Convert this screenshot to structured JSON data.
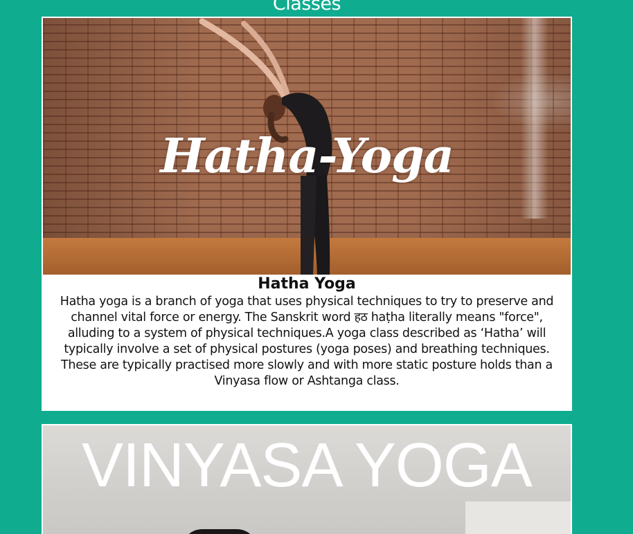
{
  "page": {
    "section_heading": "Classes"
  },
  "classes": [
    {
      "image_caption": "Hatha-Yoga",
      "title": "Hatha Yoga",
      "description": "Hatha yoga is a branch of yoga that uses physical techniques to try to preserve and channel vital force or energy. The Sanskrit word हठ haṭha literally means \"force\", alluding to a system of physical techniques.A yoga class described as ‘Hatha’ will typically involve a set of physical postures (yoga poses) and breathing techniques. These are typically practised more slowly and with more static posture holds than a Vinyasa flow or Ashtanga class."
    },
    {
      "image_caption": "VINYASA YOGA"
    }
  ],
  "colors": {
    "background": "#10ac8f",
    "card": "#ffffff",
    "text": "#111111"
  }
}
